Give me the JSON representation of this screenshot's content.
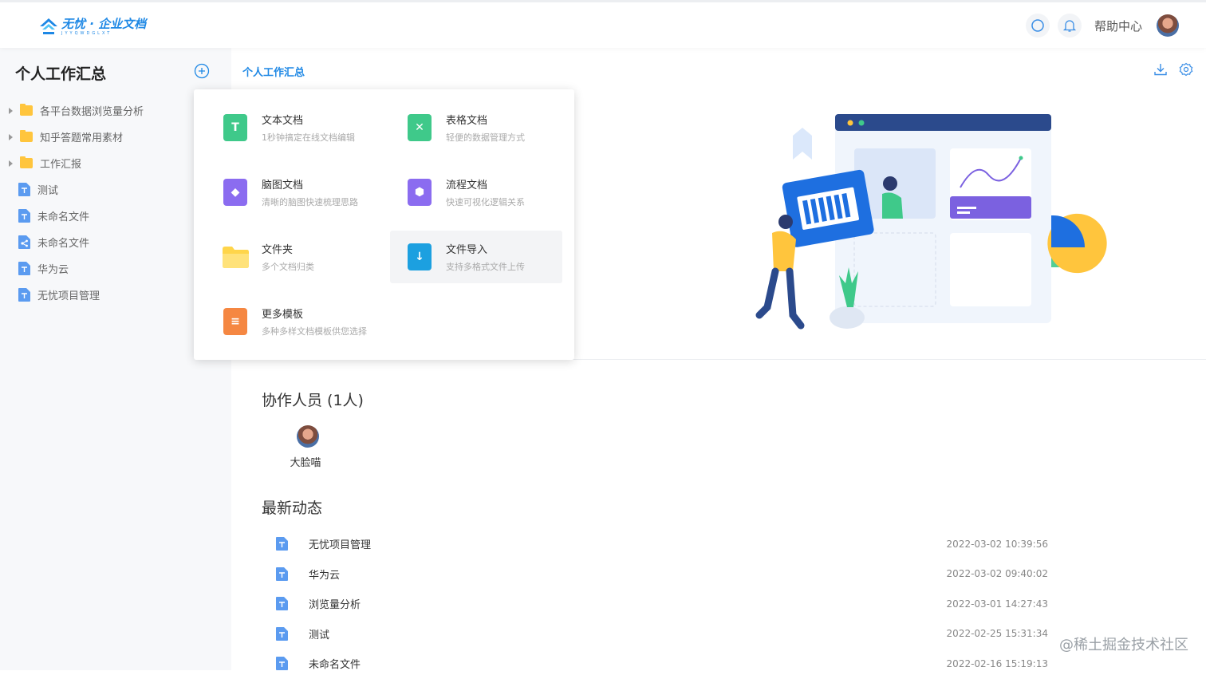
{
  "app": {
    "logo_name": "无忧 · 企业文档",
    "logo_sub": "JYYQWDGLXT"
  },
  "header": {
    "help_label": "帮助中心",
    "icons": [
      "search-icon",
      "bell-icon",
      "user-avatar"
    ]
  },
  "sidebar": {
    "title": "个人工作汇总",
    "items": [
      {
        "label": "各平台数据浏览量分析",
        "type": "folder"
      },
      {
        "label": "知乎答题常用素材",
        "type": "folder"
      },
      {
        "label": "工作汇报",
        "type": "folder"
      },
      {
        "label": "测试",
        "type": "doc"
      },
      {
        "label": "未命名文件",
        "type": "doc"
      },
      {
        "label": "未命名文件",
        "type": "mind"
      },
      {
        "label": "华为云",
        "type": "doc"
      },
      {
        "label": "无忧项目管理",
        "type": "doc"
      }
    ]
  },
  "main": {
    "breadcrumb": "个人工作汇总",
    "collab_title": "协作人员 (1人)",
    "collaborators": [
      {
        "name": "大脸喵"
      }
    ],
    "activity_title": "最新动态",
    "activity": [
      {
        "name": "无忧项目管理",
        "time": "2022-03-02 10:39:56"
      },
      {
        "name": "华为云",
        "time": "2022-03-02 09:40:02"
      },
      {
        "name": "浏览量分析",
        "time": "2022-03-01 14:27:43"
      },
      {
        "name": "测试",
        "time": "2022-02-25 15:31:34"
      },
      {
        "name": "未命名文件",
        "time": "2022-02-16 15:19:13"
      }
    ]
  },
  "create_menu": {
    "items": [
      {
        "name": "文本文档",
        "desc": "1秒钟搞定在线文档编辑",
        "color": "#3fc98a",
        "glyph": "T"
      },
      {
        "name": "表格文档",
        "desc": "轻便的数据管理方式",
        "color": "#3fc98a",
        "glyph": "✕"
      },
      {
        "name": "脑图文档",
        "desc": "清晰的脑图快速梳理思路",
        "color": "#8b6cf0",
        "glyph": "◆"
      },
      {
        "name": "流程文档",
        "desc": "快速可视化逻辑关系",
        "color": "#8b6cf0",
        "glyph": "⬢"
      },
      {
        "name": "文件夹",
        "desc": "多个文档归类",
        "color": "#ffd54a",
        "glyph": ""
      },
      {
        "name": "文件导入",
        "desc": "支持多格式文件上传",
        "color": "#1ca0e0",
        "glyph": "↓"
      },
      {
        "name": "更多模板",
        "desc": "多种多样文档模板供您选择",
        "color": "#f58742",
        "glyph": "≡"
      }
    ]
  },
  "watermark": "@稀土掘金技术社区"
}
